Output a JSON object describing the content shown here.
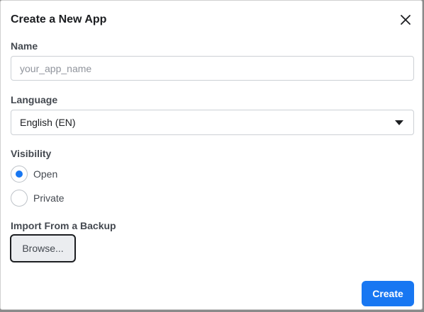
{
  "dialog": {
    "title": "Create a New App",
    "close_icon": "close-icon"
  },
  "name_field": {
    "label": "Name",
    "value": "",
    "placeholder": "your_app_name"
  },
  "language_field": {
    "label": "Language",
    "selected": "English (EN)",
    "dropdown_icon": "caret-down-icon"
  },
  "visibility": {
    "label": "Visibility",
    "options": [
      {
        "label": "Open",
        "checked": true
      },
      {
        "label": "Private",
        "checked": false
      }
    ]
  },
  "import": {
    "label": "Import From a Backup",
    "browse_label": "Browse..."
  },
  "actions": {
    "create_label": "Create"
  },
  "colors": {
    "accent": "#1877f2",
    "text": "#1c1e21",
    "muted_text": "#444950",
    "border": "#ccd0d5"
  }
}
